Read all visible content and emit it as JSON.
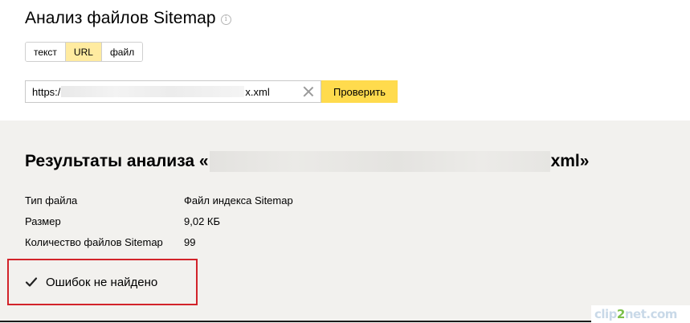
{
  "header": {
    "title": "Анализ файлов Sitemap",
    "info_icon": "i"
  },
  "tabs": [
    {
      "label": "текст",
      "active": false
    },
    {
      "label": "URL",
      "active": true
    },
    {
      "label": "файл",
      "active": false
    }
  ],
  "url_input": {
    "value_prefix": "https:/",
    "value_suffix": "x.xml"
  },
  "check_button": {
    "label": "Проверить"
  },
  "results": {
    "title_prefix": "Результаты анализа «",
    "title_suffix": "xml»",
    "rows": [
      {
        "label": "Тип файла",
        "value": "Файл индекса Sitemap"
      },
      {
        "label": "Размер",
        "value": "9,02 КБ"
      },
      {
        "label": "Количество файлов Sitemap",
        "value": "99"
      }
    ],
    "status": "Ошибок не найдено"
  },
  "watermark": {
    "part1": "clip",
    "two": "2",
    "part2": "net.com"
  },
  "colors": {
    "accent_button": "#ffdb4d",
    "active_tab": "#ffeba0",
    "results_bg": "#f2f1ee",
    "highlight_border": "#d2232a"
  }
}
